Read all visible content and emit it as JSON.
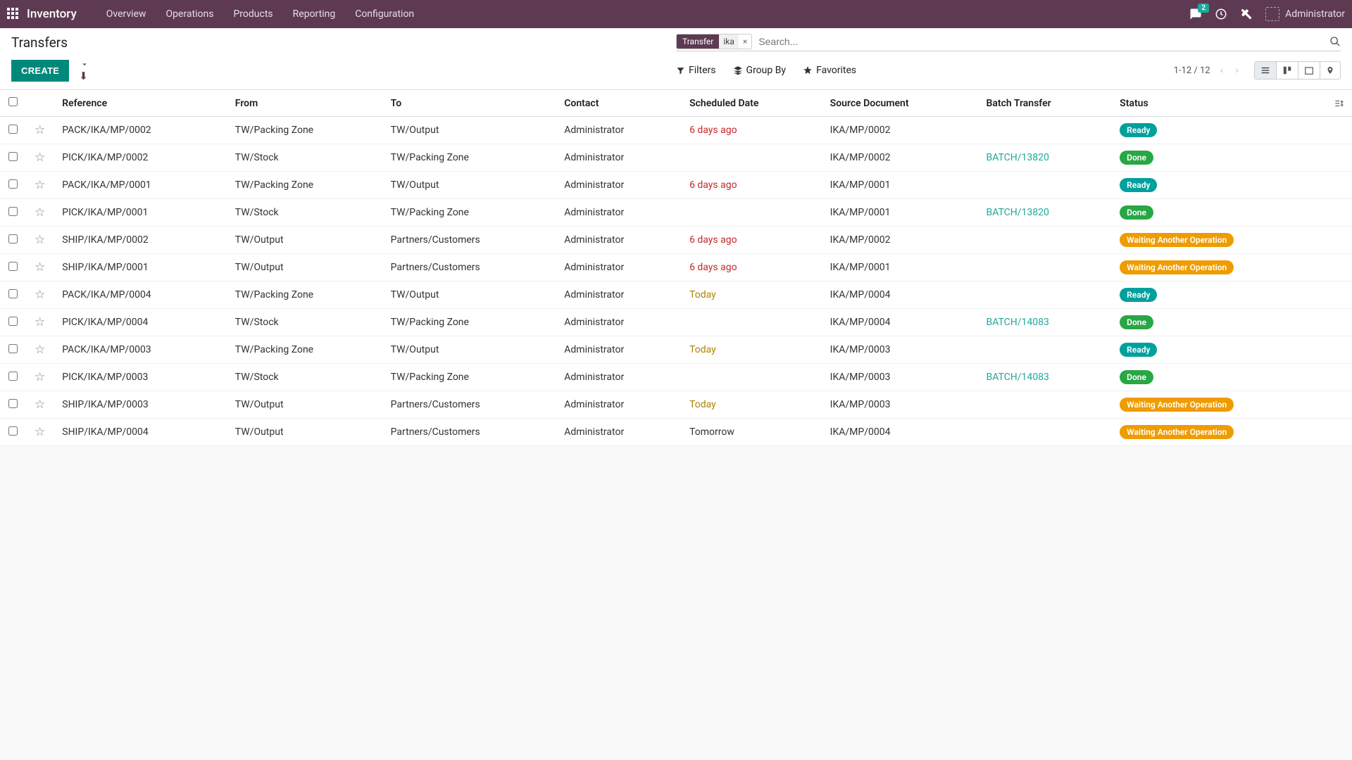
{
  "nav": {
    "brand": "Inventory",
    "links": [
      "Overview",
      "Operations",
      "Products",
      "Reporting",
      "Configuration"
    ],
    "msg_count": "2",
    "user": "Administrator"
  },
  "breadcrumb": "Transfers",
  "search": {
    "facet_label": "Transfer",
    "facet_value": "ika",
    "placeholder": "Search..."
  },
  "buttons": {
    "create": "CREATE",
    "filters": "Filters",
    "groupby": "Group By",
    "favorites": "Favorites"
  },
  "pager": "1-12 / 12",
  "columns": [
    "Reference",
    "From",
    "To",
    "Contact",
    "Scheduled Date",
    "Source Document",
    "Batch Transfer",
    "Status"
  ],
  "rows": [
    {
      "ref": "PACK/IKA/MP/0002",
      "from": "TW/Packing Zone",
      "to": "TW/Output",
      "contact": "Administrator",
      "date": "6 days ago",
      "date_cls": "date-overdue",
      "src": "IKA/MP/0002",
      "batch": "",
      "status": "Ready",
      "st_cls": "st-ready"
    },
    {
      "ref": "PICK/IKA/MP/0002",
      "from": "TW/Stock",
      "to": "TW/Packing Zone",
      "contact": "Administrator",
      "date": "",
      "date_cls": "",
      "src": "IKA/MP/0002",
      "batch": "BATCH/13820",
      "status": "Done",
      "st_cls": "st-done"
    },
    {
      "ref": "PACK/IKA/MP/0001",
      "from": "TW/Packing Zone",
      "to": "TW/Output",
      "contact": "Administrator",
      "date": "6 days ago",
      "date_cls": "date-overdue",
      "src": "IKA/MP/0001",
      "batch": "",
      "status": "Ready",
      "st_cls": "st-ready"
    },
    {
      "ref": "PICK/IKA/MP/0001",
      "from": "TW/Stock",
      "to": "TW/Packing Zone",
      "contact": "Administrator",
      "date": "",
      "date_cls": "",
      "src": "IKA/MP/0001",
      "batch": "BATCH/13820",
      "status": "Done",
      "st_cls": "st-done"
    },
    {
      "ref": "SHIP/IKA/MP/0002",
      "from": "TW/Output",
      "to": "Partners/Customers",
      "contact": "Administrator",
      "date": "6 days ago",
      "date_cls": "date-overdue",
      "src": "IKA/MP/0002",
      "batch": "",
      "status": "Waiting Another Operation",
      "st_cls": "st-wait"
    },
    {
      "ref": "SHIP/IKA/MP/0001",
      "from": "TW/Output",
      "to": "Partners/Customers",
      "contact": "Administrator",
      "date": "6 days ago",
      "date_cls": "date-overdue",
      "src": "IKA/MP/0001",
      "batch": "",
      "status": "Waiting Another Operation",
      "st_cls": "st-wait"
    },
    {
      "ref": "PACK/IKA/MP/0004",
      "from": "TW/Packing Zone",
      "to": "TW/Output",
      "contact": "Administrator",
      "date": "Today",
      "date_cls": "date-today",
      "src": "IKA/MP/0004",
      "batch": "",
      "status": "Ready",
      "st_cls": "st-ready"
    },
    {
      "ref": "PICK/IKA/MP/0004",
      "from": "TW/Stock",
      "to": "TW/Packing Zone",
      "contact": "Administrator",
      "date": "",
      "date_cls": "",
      "src": "IKA/MP/0004",
      "batch": "BATCH/14083",
      "status": "Done",
      "st_cls": "st-done"
    },
    {
      "ref": "PACK/IKA/MP/0003",
      "from": "TW/Packing Zone",
      "to": "TW/Output",
      "contact": "Administrator",
      "date": "Today",
      "date_cls": "date-today",
      "src": "IKA/MP/0003",
      "batch": "",
      "status": "Ready",
      "st_cls": "st-ready"
    },
    {
      "ref": "PICK/IKA/MP/0003",
      "from": "TW/Stock",
      "to": "TW/Packing Zone",
      "contact": "Administrator",
      "date": "",
      "date_cls": "",
      "src": "IKA/MP/0003",
      "batch": "BATCH/14083",
      "status": "Done",
      "st_cls": "st-done"
    },
    {
      "ref": "SHIP/IKA/MP/0003",
      "from": "TW/Output",
      "to": "Partners/Customers",
      "contact": "Administrator",
      "date": "Today",
      "date_cls": "date-today",
      "src": "IKA/MP/0003",
      "batch": "",
      "status": "Waiting Another Operation",
      "st_cls": "st-wait"
    },
    {
      "ref": "SHIP/IKA/MP/0004",
      "from": "TW/Output",
      "to": "Partners/Customers",
      "contact": "Administrator",
      "date": "Tomorrow",
      "date_cls": "",
      "src": "IKA/MP/0004",
      "batch": "",
      "status": "Waiting Another Operation",
      "st_cls": "st-wait"
    }
  ]
}
